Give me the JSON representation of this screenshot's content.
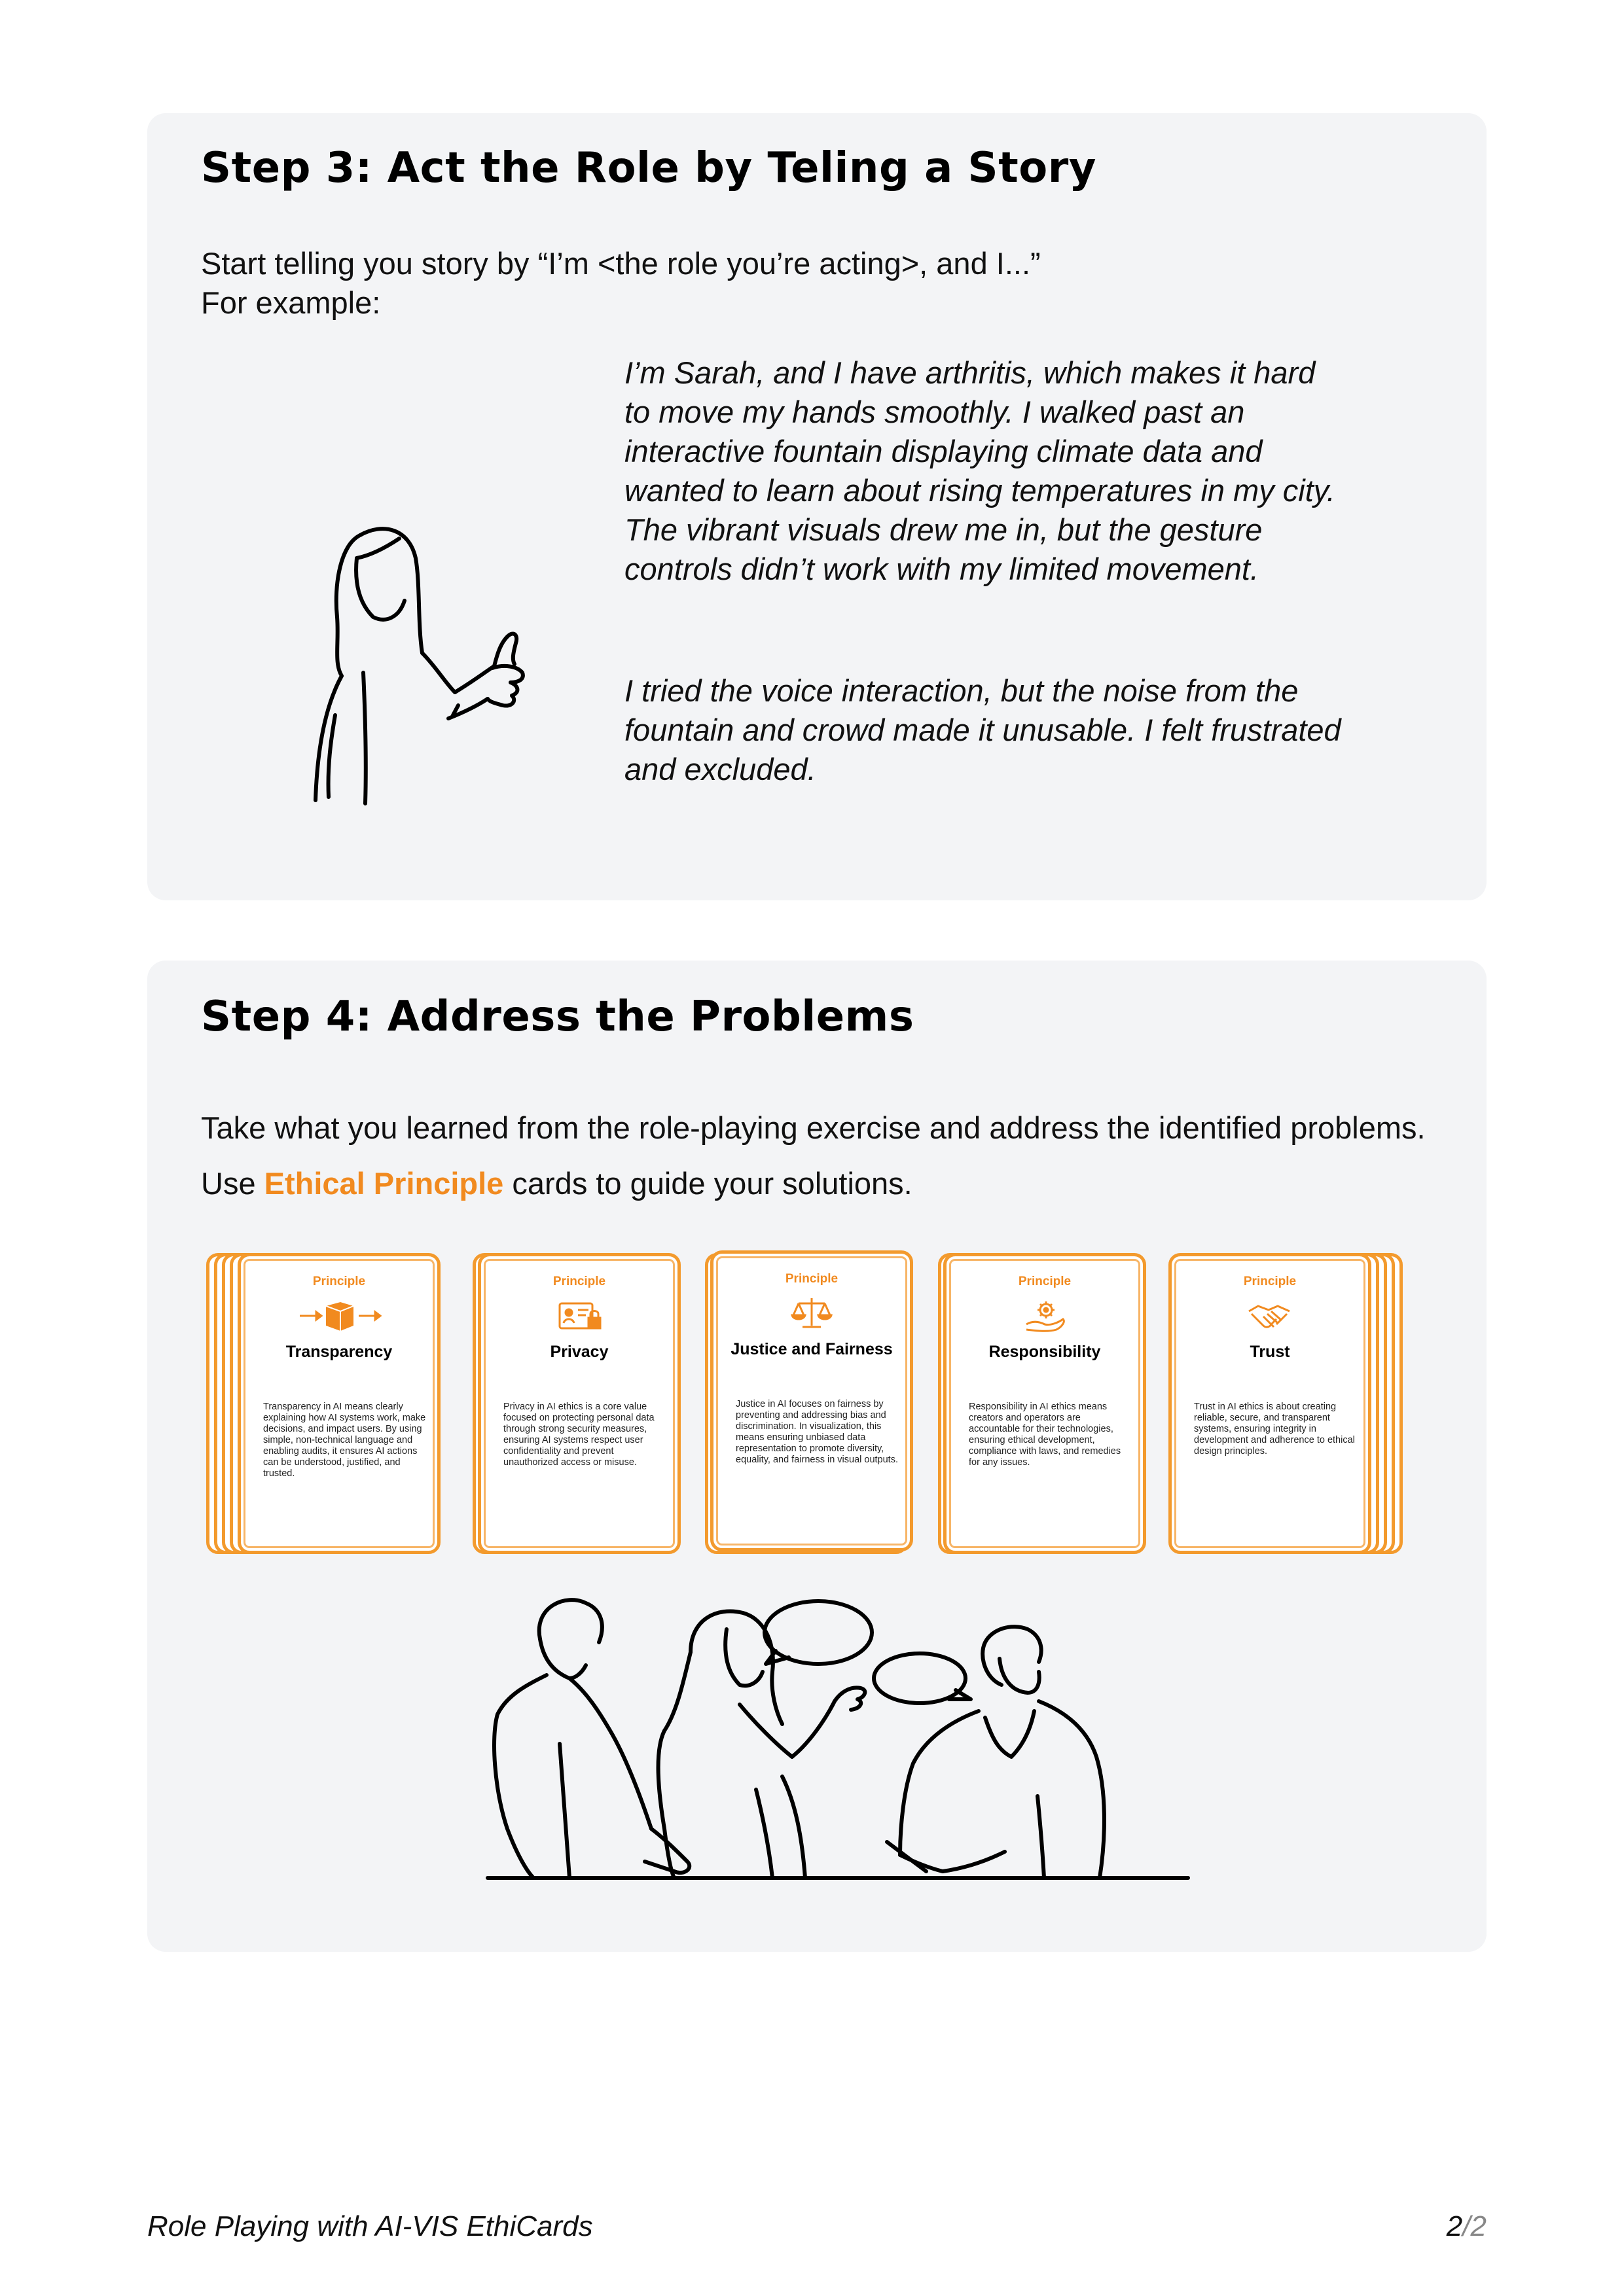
{
  "step3": {
    "title": "Step 3: Act the Role by Teling a Story",
    "intro_line1": "Start telling you story by “I’m <the role you’re acting>, and I...”",
    "intro_line2": "For example:",
    "story_p1": "I’m Sarah, and I have arthritis, which makes it hard to move my hands smoothly. I walked past an interactive fountain displaying climate data and wanted to learn about rising temperatures in my city. The vibrant visuals drew me in, but the gesture controls didn’t work with my limited movement.",
    "story_p2": "I tried the voice interaction, but the noise from the fountain and crowd made it unusable. I felt frustrated and excluded."
  },
  "step4": {
    "title": "Step 4: Address the Problems",
    "intro_before": "Take what you learned from the role-playing exercise and address the identified problems. Use ",
    "intro_highlight": "Ethical Principle",
    "intro_after": " cards to guide your solutions."
  },
  "cards": [
    {
      "label": "Principle",
      "name": "Transparency",
      "icon": "box-arrows-icon",
      "description": "Transparency in AI means clearly explaining how AI systems work, make decisions, and impact users. By using simple, non-technical language and enabling audits, it ensures AI actions can be understood, justified, and trusted."
    },
    {
      "label": "Principle",
      "name": "Privacy",
      "icon": "id-card-lock-icon",
      "description": "Privacy in AI ethics is a core value focused on protecting personal data through strong security measures, ensuring AI systems respect user confidentiality and prevent unauthorized access or misuse."
    },
    {
      "label": "Principle",
      "name": "Justice and Fairness",
      "icon": "scales-icon",
      "description": "Justice in AI focuses on fairness by preventing and addressing bias and discrimination. In visualization, this means ensuring unbiased data representation to promote diversity, equality, and fairness in visual outputs."
    },
    {
      "label": "Principle",
      "name": "Responsibility",
      "icon": "hand-gear-icon",
      "description": "Responsibility in AI ethics means creators and operators are accountable for their technologies, ensuring ethical development, compliance with laws, and remedies for any issues."
    },
    {
      "label": "Principle",
      "name": "Trust",
      "icon": "handshake-icon",
      "description": "Trust in AI ethics is about creating reliable, secure, and transparent systems, ensuring integrity in development and adherence to ethical design principles."
    }
  ],
  "footer": {
    "title": "Role Playing with AI-VIS EthiCards",
    "page_current": "2",
    "page_sep": "/",
    "page_total": "2"
  },
  "colors": {
    "accent": "#f18a1f",
    "card_border": "#f39a2d",
    "panel_bg": "#f3f4f6"
  }
}
